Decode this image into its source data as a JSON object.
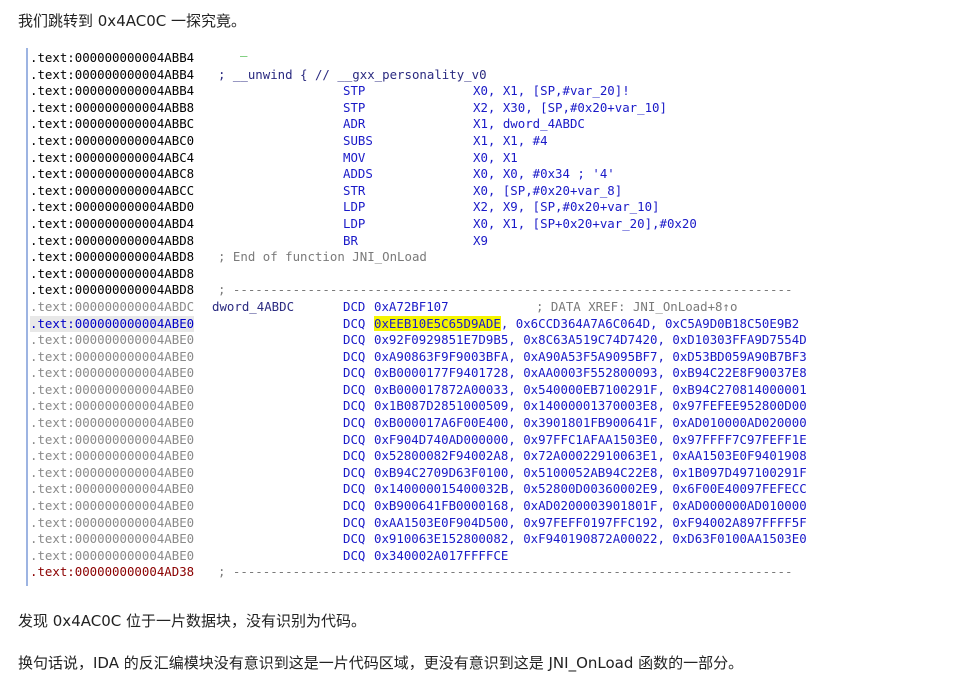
{
  "intro": "我们跳转到 0x4AC0C 一探究竟。",
  "outro1": "发现 0x4AC0C 位于一片数据块，没有识别为代码。",
  "outro2": "换句话说，IDA 的反汇编模块没有意识到这是一片代码区域，更没有意识到这是 JNI_OnLoad 函数的一部分。",
  "code": {
    "top_marker": "_",
    "rows": [
      {
        "type": "plain",
        "addr": ".text:000000000004ABB4",
        "rest": ""
      },
      {
        "type": "unwind",
        "addr": ".text:000000000004ABB4",
        "comment": "; __unwind { // __gxx_personality_v0"
      },
      {
        "type": "instr",
        "addr": ".text:000000000004ABB4",
        "mnem": "STP",
        "ops": "X0, X1, [SP,#var_20]!"
      },
      {
        "type": "instr",
        "addr": ".text:000000000004ABB8",
        "mnem": "STP",
        "ops": "X2, X30, [SP,#0x20+var_10]"
      },
      {
        "type": "instr",
        "addr": ".text:000000000004ABBC",
        "mnem": "ADR",
        "ops": "X1, dword_4ABDC"
      },
      {
        "type": "instr",
        "addr": ".text:000000000004ABC0",
        "mnem": "SUBS",
        "ops": "X1, X1, #4"
      },
      {
        "type": "instr",
        "addr": ".text:000000000004ABC4",
        "mnem": "MOV",
        "ops": "X0, X1"
      },
      {
        "type": "instr",
        "addr": ".text:000000000004ABC8",
        "mnem": "ADDS",
        "ops": "X0, X0, #0x34 ; '4'"
      },
      {
        "type": "instr",
        "addr": ".text:000000000004ABCC",
        "mnem": "STR",
        "ops": "X0, [SP,#0x20+var_8]"
      },
      {
        "type": "instr",
        "addr": ".text:000000000004ABD0",
        "mnem": "LDP",
        "ops": "X2, X9, [SP,#0x20+var_10]"
      },
      {
        "type": "instr",
        "addr": ".text:000000000004ABD4",
        "mnem": "LDP",
        "ops": "X0, X1, [SP+0x20+var_20],#0x20"
      },
      {
        "type": "instr",
        "addr": ".text:000000000004ABD8",
        "mnem": "BR",
        "ops": "X9"
      },
      {
        "type": "endfn",
        "addr": ".text:000000000004ABD8",
        "comment": "; End of function JNI_OnLoad"
      },
      {
        "type": "plain",
        "addr": ".text:000000000004ABD8",
        "rest": ""
      },
      {
        "type": "sep",
        "addr": ".text:000000000004ABD8",
        "comment": "; ---------------------------------------------------------------------------"
      },
      {
        "type": "label",
        "addr": ".text:000000000004ABDC",
        "label": "dword_4ABDC",
        "mnem": "DCD",
        "ops": "0xA72BF107",
        "comment": "; DATA XREF: JNI_OnLoad+8↑o"
      },
      {
        "type": "dcq_sel",
        "addr": ".text:000000000004ABE0",
        "mnem": "DCQ",
        "hl": "0xEEB10E5C65D9ADE",
        "ops": ", 0x6CCD364A7A6C064D, 0xC5A9D0B18C50E9B2"
      },
      {
        "type": "dcq",
        "addr": ".text:000000000004ABE0",
        "mnem": "DCQ",
        "ops": "0x92F0929851E7D9B5, 0x8C63A519C74D7420, 0xD10303FFA9D7554D"
      },
      {
        "type": "dcq",
        "addr": ".text:000000000004ABE0",
        "mnem": "DCQ",
        "ops": "0xA90863F9F9003BFA, 0xA90A53F5A9095BF7, 0xD53BD059A90B7BF3"
      },
      {
        "type": "dcq",
        "addr": ".text:000000000004ABE0",
        "mnem": "DCQ",
        "ops": "0xB0000177F9401728, 0xAA0003F552800093, 0xB94C22E8F90037E8"
      },
      {
        "type": "dcq",
        "addr": ".text:000000000004ABE0",
        "mnem": "DCQ",
        "ops": "0xB000017872A00033, 0x540000EB7100291F, 0xB94C270814000001"
      },
      {
        "type": "dcq",
        "addr": ".text:000000000004ABE0",
        "mnem": "DCQ",
        "ops": "0x1B087D2851000509, 0x14000001370003E8, 0x97FEFEE952800D00"
      },
      {
        "type": "dcq",
        "addr": ".text:000000000004ABE0",
        "mnem": "DCQ",
        "ops": "0xB000017A6F00E400, 0x3901801FB900641F, 0xAD010000AD020000"
      },
      {
        "type": "dcq",
        "addr": ".text:000000000004ABE0",
        "mnem": "DCQ",
        "ops": "0xF904D740AD000000, 0x97FFC1AFAA1503E0, 0x97FFFF7C97FEFF1E"
      },
      {
        "type": "dcq",
        "addr": ".text:000000000004ABE0",
        "mnem": "DCQ",
        "ops": "0x52800082F94002A8, 0x72A00022910063E1, 0xAA1503E0F9401908"
      },
      {
        "type": "dcq",
        "addr": ".text:000000000004ABE0",
        "mnem": "DCQ",
        "ops": "0xB94C2709D63F0100, 0x5100052AB94C22E8, 0x1B097D497100291F"
      },
      {
        "type": "dcq",
        "addr": ".text:000000000004ABE0",
        "mnem": "DCQ",
        "ops": "0x140000015400032B, 0x52800D00360002E9, 0x6F00E40097FEFECC"
      },
      {
        "type": "dcq",
        "addr": ".text:000000000004ABE0",
        "mnem": "DCQ",
        "ops": "0xB900641FB0000168, 0xAD0200003901801F, 0xAD000000AD010000"
      },
      {
        "type": "dcq",
        "addr": ".text:000000000004ABE0",
        "mnem": "DCQ",
        "ops": "0xAA1503E0F904D500, 0x97FEFF0197FFC192, 0xF94002A897FFFF5F"
      },
      {
        "type": "dcq",
        "addr": ".text:000000000004ABE0",
        "mnem": "DCQ",
        "ops": "0x910063E152800082, 0xF940190872A00022, 0xD63F0100AA1503E0"
      },
      {
        "type": "dcq",
        "addr": ".text:000000000004ABE0",
        "mnem": "DCQ",
        "ops": "0x340002A017FFFFCE"
      },
      {
        "type": "sepred",
        "addr": ".text:000000000004AD38",
        "comment": "; ---------------------------------------------------------------------------"
      }
    ]
  }
}
